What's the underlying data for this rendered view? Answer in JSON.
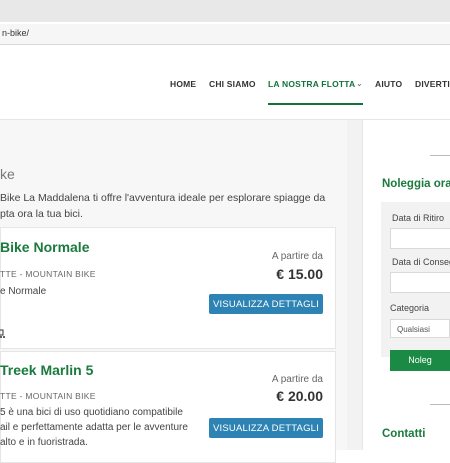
{
  "browser": {
    "url": "n-bike/"
  },
  "nav": {
    "items": [
      "HOME",
      "CHI SIAMO",
      "LA NOSTRA FLOTTA",
      "AIUTO",
      "DIVERTI"
    ],
    "active_index": 2
  },
  "page": {
    "heading": "ke",
    "intro_line1": "Bike La Maddalena ti offre l'avventura ideale per esplorare spiagge da",
    "intro_line2": "pta ora la tua bici."
  },
  "cards": [
    {
      "title": "Bike Normale",
      "category": "TTE - MOUNTAIN BIKE",
      "desc": "e Normale",
      "price_label": "A partire da",
      "price": "€ 15.00",
      "button": "VISUALIZZA DETTAGLI"
    },
    {
      "title": "Treek Marlin 5",
      "category": "TTE - MOUNTAIN BIKE",
      "desc_line1": "5 è una bici di uso quotidiano compatibile",
      "desc_line2": "ail e perfettamente adatta per le avventure",
      "desc_line3": "alto e in fuoristrada.",
      "price_label": "A partire da",
      "price": "€ 20.00",
      "button": "VISUALIZZA DETTAGLI"
    }
  ],
  "sidebar": {
    "rent_title": "Noleggia ora",
    "pickup_label": "Data di Ritiro",
    "return_label": "Data di Conseg",
    "category_label": "Categoria",
    "category_value": "Qualsiasi",
    "submit": "Noleg",
    "contacts_title": "Contatti"
  },
  "colors": {
    "brand_green": "#1b7a3d",
    "button_blue": "#2d83b4",
    "side_button_green": "#1b8a45"
  }
}
